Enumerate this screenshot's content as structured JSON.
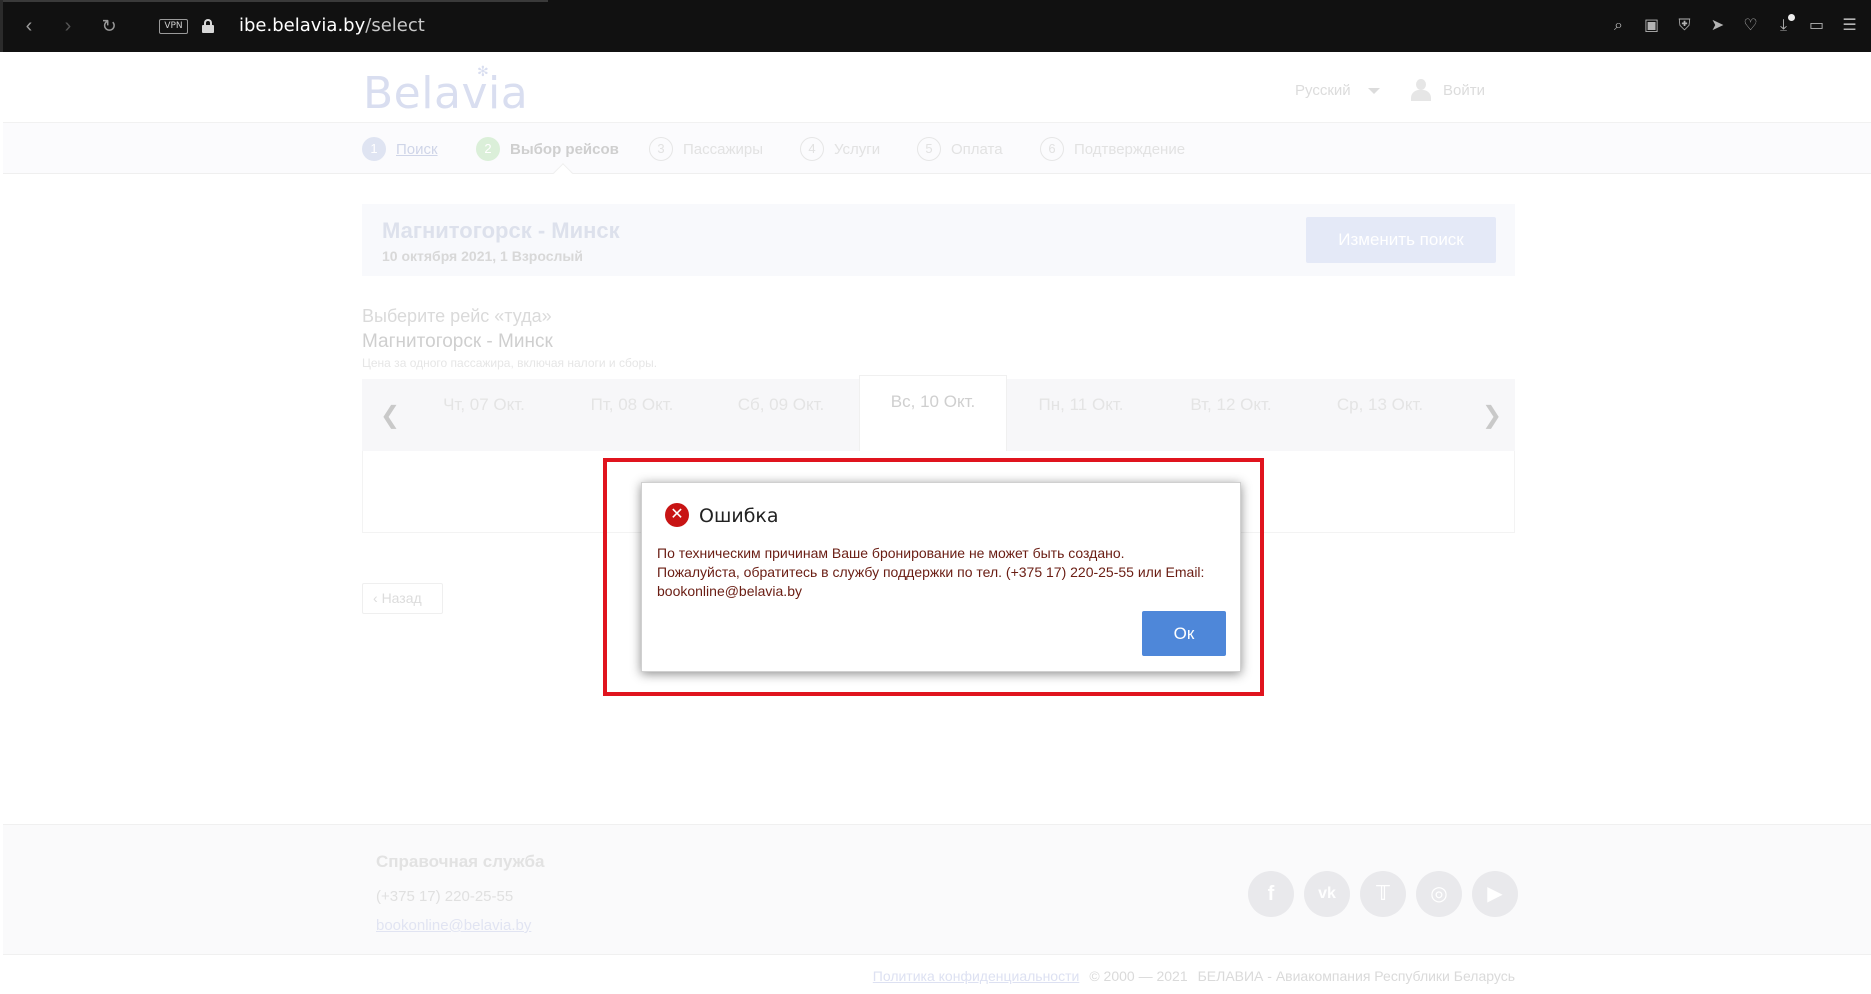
{
  "browser": {
    "vpn_label": "VPN",
    "url_domain": "ibe.belavia.by",
    "url_path": "/select",
    "icons": [
      "back-icon",
      "forward-icon",
      "reload-icon",
      "search-icon",
      "camera-icon",
      "shield-icon",
      "send-icon",
      "heart-icon",
      "download-icon",
      "battery-icon",
      "menu-icon"
    ]
  },
  "header": {
    "logo": "Belavia",
    "language": "Русский",
    "login": "Войти"
  },
  "steps": [
    {
      "num": "1",
      "label": "Поиск"
    },
    {
      "num": "2",
      "label": "Выбор рейсов"
    },
    {
      "num": "3",
      "label": "Пассажиры"
    },
    {
      "num": "4",
      "label": "Услуги"
    },
    {
      "num": "5",
      "label": "Оплата"
    },
    {
      "num": "6",
      "label": "Подтверждение"
    }
  ],
  "summary": {
    "route": "Магнитогорск - Минск",
    "details": "10 октября 2021, 1 Взрослый",
    "change_button": "Изменить поиск"
  },
  "selection": {
    "title": "Выберите рейс «туда»",
    "route": "Магнитогорск - Минск",
    "note": "Цена за одного пассажира, включая налоги и сборы.",
    "dates": [
      "Чт, 07 Окт.",
      "Пт, 08 Окт.",
      "Сб, 09 Окт.",
      "Вс, 10 Окт.",
      "Пн, 11 Окт.",
      "Вт, 12 Окт.",
      "Ср, 13 Окт."
    ],
    "back_button": "Назад"
  },
  "dialog": {
    "title": "Ошибка",
    "line1": "По техническим причинам Ваше бронирование не может быть создано.",
    "line2": "Пожалуйста, обратитесь в службу поддержки по тел. (+375 17) 220-25-55 или Email:",
    "line3": "bookonline@belavia.by",
    "ok_button": "Ок",
    "accent_color": "#e0141e"
  },
  "footer": {
    "title": "Справочная служба",
    "phone": "(+375 17) 220-25-55",
    "email": "bookonline@belavia.by",
    "socials": [
      "facebook-icon",
      "vk-icon",
      "twitter-icon",
      "instagram-icon",
      "youtube-icon"
    ],
    "privacy": "Политика конфиденциальности",
    "copyright": "© 2000 — 2021",
    "company": "БЕЛАВИА - Авиакомпания Республики Беларусь"
  }
}
